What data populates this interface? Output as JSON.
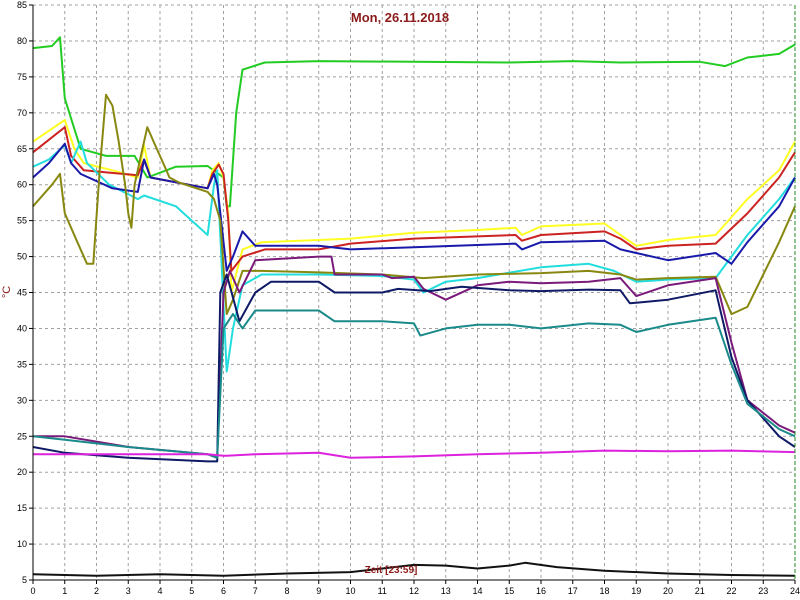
{
  "chart_data": {
    "type": "line",
    "title": "Mon, 26.11.2018",
    "ylabel": "°C",
    "annotation": "Zeit [23:59]",
    "xlim": [
      0,
      24
    ],
    "ylim": [
      5,
      85
    ],
    "x_ticks": [
      "0",
      "1",
      "2",
      "3",
      "4",
      "5",
      "6",
      "7",
      "8",
      "9",
      "10",
      "11",
      "12",
      "13",
      "14",
      "15",
      "16",
      "17",
      "18",
      "19",
      "20",
      "21",
      "22",
      "23",
      "24"
    ],
    "y_ticks": [
      "5",
      "10",
      "15",
      "20",
      "25",
      "30",
      "35",
      "40",
      "45",
      "50",
      "55",
      "60",
      "65",
      "70",
      "75",
      "80",
      "85"
    ],
    "grid": true,
    "series": [
      {
        "color": "#22cc22",
        "points": [
          [
            0,
            79
          ],
          [
            0.6,
            79.3
          ],
          [
            0.85,
            80.5
          ],
          [
            1.0,
            72
          ],
          [
            1.5,
            65
          ],
          [
            2.3,
            64
          ],
          [
            3.2,
            64
          ],
          [
            3.6,
            61
          ],
          [
            4.5,
            62.5
          ],
          [
            5.5,
            62.6
          ],
          [
            6.0,
            61
          ],
          [
            6.1,
            57
          ],
          [
            6.2,
            57
          ],
          [
            6.4,
            70
          ],
          [
            6.6,
            76
          ],
          [
            7.3,
            77
          ],
          [
            9,
            77.2
          ],
          [
            12,
            77.1
          ],
          [
            15,
            77
          ],
          [
            17,
            77.2
          ],
          [
            18.5,
            77
          ],
          [
            21,
            77.1
          ],
          [
            21.8,
            76.5
          ],
          [
            22.5,
            77.7
          ],
          [
            23.5,
            78.2
          ],
          [
            24,
            79.5
          ]
        ]
      },
      {
        "color": "#ffff22",
        "points": [
          [
            0,
            66
          ],
          [
            1,
            69
          ],
          [
            1.3,
            65
          ],
          [
            1.6,
            63
          ],
          [
            2.5,
            62
          ],
          [
            3.3,
            61
          ],
          [
            3.5,
            65.5
          ],
          [
            3.7,
            61
          ],
          [
            5.5,
            59.5
          ],
          [
            5.65,
            62
          ],
          [
            5.85,
            63
          ],
          [
            6.0,
            61
          ],
          [
            6.15,
            56
          ],
          [
            6.25,
            45
          ],
          [
            6.6,
            51
          ],
          [
            7.2,
            52
          ],
          [
            9,
            52.3
          ],
          [
            10,
            52.5
          ],
          [
            12,
            53.3
          ],
          [
            14,
            53.7
          ],
          [
            15.2,
            54
          ],
          [
            15.4,
            53
          ],
          [
            16,
            54.2
          ],
          [
            18,
            54.6
          ],
          [
            18.5,
            53
          ],
          [
            19,
            51.5
          ],
          [
            20,
            52.3
          ],
          [
            21.5,
            53
          ],
          [
            22.5,
            58
          ],
          [
            23.5,
            62
          ],
          [
            24,
            66
          ]
        ]
      },
      {
        "color": "#cc2222",
        "points": [
          [
            0,
            64.5
          ],
          [
            1,
            68
          ],
          [
            1.2,
            64
          ],
          [
            1.6,
            62
          ],
          [
            3.3,
            61.3
          ],
          [
            3.5,
            63.5
          ],
          [
            3.7,
            61
          ],
          [
            5.5,
            59.5
          ],
          [
            5.65,
            61.5
          ],
          [
            5.85,
            62.8
          ],
          [
            6.0,
            61.5
          ],
          [
            6.15,
            55
          ],
          [
            6.25,
            48
          ],
          [
            6.6,
            50
          ],
          [
            7.3,
            51
          ],
          [
            9,
            51
          ],
          [
            10,
            51.8
          ],
          [
            12,
            52.5
          ],
          [
            14,
            52.8
          ],
          [
            15.2,
            53
          ],
          [
            15.4,
            52.2
          ],
          [
            16,
            53
          ],
          [
            18,
            53.5
          ],
          [
            18.5,
            52.5
          ],
          [
            19,
            51
          ],
          [
            20,
            51.5
          ],
          [
            21.5,
            51.8
          ],
          [
            22.5,
            56
          ],
          [
            23.5,
            61
          ],
          [
            24,
            64.5
          ]
        ]
      },
      {
        "color": "#22dddd",
        "points": [
          [
            0,
            62.5
          ],
          [
            0.5,
            63.5
          ],
          [
            1,
            65.5
          ],
          [
            1.2,
            63
          ],
          [
            1.5,
            66
          ],
          [
            1.7,
            63
          ],
          [
            2.4,
            60
          ],
          [
            3.3,
            58
          ],
          [
            3.5,
            58.5
          ],
          [
            4.5,
            57
          ],
          [
            5.5,
            53
          ],
          [
            5.7,
            60
          ],
          [
            5.8,
            62
          ],
          [
            6.1,
            34
          ],
          [
            6.3,
            40
          ],
          [
            6.6,
            46
          ],
          [
            7.2,
            47.5
          ],
          [
            9,
            47.5
          ],
          [
            11,
            47.3
          ],
          [
            12,
            46.8
          ],
          [
            12.3,
            45
          ],
          [
            13,
            46.5
          ],
          [
            14,
            47
          ],
          [
            16,
            48.5
          ],
          [
            17.5,
            49
          ],
          [
            18.3,
            48
          ],
          [
            19,
            46.5
          ],
          [
            20,
            46.8
          ],
          [
            21.5,
            47
          ],
          [
            22.5,
            53
          ],
          [
            23.5,
            58
          ],
          [
            24,
            61
          ]
        ]
      },
      {
        "color": "#1a1aaa",
        "points": [
          [
            0,
            61
          ],
          [
            0.5,
            63
          ],
          [
            1,
            65.7
          ],
          [
            1.2,
            63
          ],
          [
            1.5,
            61.5
          ],
          [
            2.5,
            59.5
          ],
          [
            3.3,
            59
          ],
          [
            3.5,
            63.5
          ],
          [
            3.7,
            61
          ],
          [
            5.5,
            59.5
          ],
          [
            5.7,
            61.5
          ],
          [
            5.8,
            60
          ],
          [
            6.1,
            48
          ],
          [
            6.3,
            50
          ],
          [
            6.6,
            53.5
          ],
          [
            7,
            51.5
          ],
          [
            9,
            51.5
          ],
          [
            10,
            51
          ],
          [
            12,
            51.3
          ],
          [
            15.2,
            51.8
          ],
          [
            15.4,
            51
          ],
          [
            16,
            52
          ],
          [
            18,
            52.2
          ],
          [
            18.5,
            51
          ],
          [
            19,
            50.5
          ],
          [
            20,
            49.5
          ],
          [
            21.5,
            50.5
          ],
          [
            22,
            49
          ],
          [
            22.5,
            52
          ],
          [
            23.5,
            57
          ],
          [
            24,
            61
          ]
        ]
      },
      {
        "color": "#888811",
        "points": [
          [
            0,
            57
          ],
          [
            0.6,
            60
          ],
          [
            0.85,
            61.5
          ],
          [
            1.0,
            56
          ],
          [
            1.4,
            52
          ],
          [
            1.7,
            49
          ],
          [
            1.9,
            49
          ],
          [
            2.1,
            62
          ],
          [
            2.3,
            72.5
          ],
          [
            2.5,
            71
          ],
          [
            2.7,
            66
          ],
          [
            2.9,
            60
          ],
          [
            3.0,
            56
          ],
          [
            3.1,
            54
          ],
          [
            3.2,
            60
          ],
          [
            3.4,
            64
          ],
          [
            3.6,
            68
          ],
          [
            3.8,
            66
          ],
          [
            4.1,
            63
          ],
          [
            4.3,
            61
          ],
          [
            4.6,
            60.3
          ],
          [
            5.5,
            59
          ],
          [
            5.7,
            58
          ],
          [
            5.9,
            55
          ],
          [
            6.1,
            42
          ],
          [
            6.3,
            44
          ],
          [
            6.6,
            48
          ],
          [
            7.2,
            48
          ],
          [
            9,
            47.8
          ],
          [
            11,
            47.5
          ],
          [
            12.3,
            47
          ],
          [
            14,
            47.5
          ],
          [
            16,
            47.7
          ],
          [
            17.5,
            48
          ],
          [
            18.5,
            47.5
          ],
          [
            19,
            46.8
          ],
          [
            20,
            47
          ],
          [
            21.5,
            47.2
          ],
          [
            22,
            42
          ],
          [
            22.5,
            43
          ],
          [
            23.5,
            52
          ],
          [
            24,
            57
          ]
        ]
      },
      {
        "color": "#7a1a7a",
        "points": [
          [
            0,
            25
          ],
          [
            1,
            25
          ],
          [
            3,
            23.5
          ],
          [
            5.5,
            22.5
          ],
          [
            5.8,
            22
          ],
          [
            6.0,
            45
          ],
          [
            6.2,
            48
          ],
          [
            6.5,
            45
          ],
          [
            7,
            49.5
          ],
          [
            9,
            50
          ],
          [
            9.4,
            50
          ],
          [
            9.5,
            47.5
          ],
          [
            11,
            47.5
          ],
          [
            11.3,
            47
          ],
          [
            12,
            47.2
          ],
          [
            12.3,
            45.5
          ],
          [
            13,
            44
          ],
          [
            14,
            46
          ],
          [
            15,
            46.5
          ],
          [
            16,
            46.3
          ],
          [
            17.5,
            46.5
          ],
          [
            18.5,
            47
          ],
          [
            19,
            44.5
          ],
          [
            20,
            46
          ],
          [
            21.5,
            47
          ],
          [
            22,
            38
          ],
          [
            22.5,
            30
          ],
          [
            23.5,
            26.5
          ],
          [
            24,
            25.5
          ]
        ]
      },
      {
        "color": "#0f1a66",
        "points": [
          [
            0,
            23.5
          ],
          [
            1,
            22.7
          ],
          [
            3,
            22
          ],
          [
            5.5,
            21.5
          ],
          [
            5.8,
            21.5
          ],
          [
            5.9,
            45
          ],
          [
            6.1,
            47.5
          ],
          [
            6.5,
            41
          ],
          [
            7,
            45
          ],
          [
            7.5,
            46.5
          ],
          [
            9,
            46.5
          ],
          [
            9.5,
            45
          ],
          [
            11,
            45
          ],
          [
            11.5,
            45.5
          ],
          [
            12.5,
            45.2
          ],
          [
            13.5,
            45.8
          ],
          [
            15,
            45.3
          ],
          [
            16,
            45.2
          ],
          [
            17.5,
            45.4
          ],
          [
            18.5,
            45.3
          ],
          [
            18.8,
            43.5
          ],
          [
            20,
            44
          ],
          [
            21.5,
            45.3
          ],
          [
            22,
            36
          ],
          [
            22.5,
            30
          ],
          [
            23.5,
            25
          ],
          [
            24,
            23.5
          ]
        ]
      },
      {
        "color": "#1a8a8a",
        "points": [
          [
            0,
            25
          ],
          [
            1,
            24.5
          ],
          [
            3,
            23.5
          ],
          [
            5.5,
            22.5
          ],
          [
            5.8,
            22
          ],
          [
            6.0,
            40
          ],
          [
            6.3,
            42
          ],
          [
            6.6,
            40
          ],
          [
            7,
            42.5
          ],
          [
            9,
            42.5
          ],
          [
            9.5,
            41
          ],
          [
            11,
            41
          ],
          [
            12,
            40.7
          ],
          [
            12.2,
            39
          ],
          [
            13,
            40
          ],
          [
            14,
            40.5
          ],
          [
            15,
            40.5
          ],
          [
            16,
            40
          ],
          [
            17.5,
            40.7
          ],
          [
            18.5,
            40.5
          ],
          [
            19,
            39.5
          ],
          [
            20,
            40.5
          ],
          [
            21.5,
            41.5
          ],
          [
            22,
            35
          ],
          [
            22.5,
            29.5
          ],
          [
            23.5,
            26
          ],
          [
            24,
            25
          ]
        ]
      },
      {
        "color": "#dd22dd",
        "points": [
          [
            0,
            22.5
          ],
          [
            3,
            22.5
          ],
          [
            5.5,
            22.5
          ],
          [
            6.0,
            22.3
          ],
          [
            6.1,
            22.3
          ],
          [
            7,
            22.5
          ],
          [
            9,
            22.7
          ],
          [
            10,
            22
          ],
          [
            12,
            22.2
          ],
          [
            14,
            22.5
          ],
          [
            16,
            22.7
          ],
          [
            18,
            23
          ],
          [
            20,
            22.9
          ],
          [
            22,
            23
          ],
          [
            24,
            22.8
          ]
        ]
      },
      {
        "color": "#111111",
        "points": [
          [
            0,
            5.8
          ],
          [
            2,
            5.6
          ],
          [
            4,
            5.8
          ],
          [
            6,
            5.6
          ],
          [
            8,
            5.9
          ],
          [
            10,
            6.1
          ],
          [
            11,
            6.6
          ],
          [
            12,
            7.1
          ],
          [
            13,
            7.0
          ],
          [
            14,
            6.6
          ],
          [
            15,
            7.0
          ],
          [
            15.5,
            7.4
          ],
          [
            16.5,
            6.8
          ],
          [
            18,
            6.3
          ],
          [
            20,
            5.9
          ],
          [
            22,
            5.7
          ],
          [
            24,
            5.6
          ]
        ]
      }
    ]
  }
}
